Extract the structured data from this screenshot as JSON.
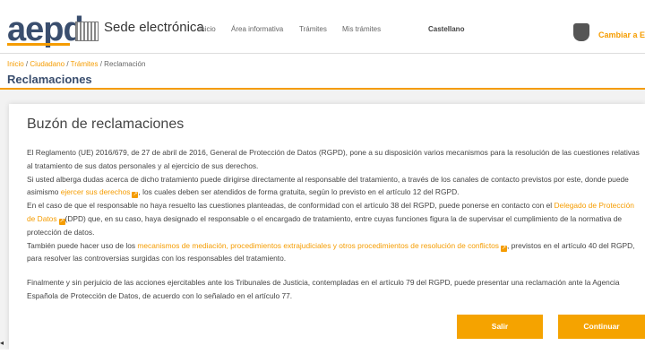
{
  "header": {
    "logo_text": "aepd",
    "site_title": "Sede electrónica",
    "nav": [
      {
        "label": "Inicio"
      },
      {
        "label": "Área informativa"
      },
      {
        "label": "Trámites"
      },
      {
        "label": "Mis trámites"
      }
    ],
    "language": "Castellano",
    "cambiar": "Cambiar a En"
  },
  "breadcrumb": {
    "inicio": "Inicio",
    "sep": "/",
    "ciudadano": "Ciudadano",
    "tramites": "Trámites",
    "current": "Reclamación"
  },
  "page_title": "Reclamaciones",
  "card": {
    "title": "Buzón de reclamaciones",
    "p1": "El Reglamento (UE) 2016/679, de 27 de abril de 2016, General de Protección de Datos (RGPD), pone a su disposición varios mecanismos para la resolución de las cuestiones relativas al tratamiento de sus datos personales y al ejercicio de sus derechos.",
    "p2_a": "Si usted alberga dudas acerca de dicho tratamiento puede dirigirse directamente al responsable del tratamiento, a través de los canales de contacto previstos por este, donde puede asimismo",
    "p2_link": "ejercer sus derechos",
    "p2_b": ", los cuales deben ser atendidos de forma gratuita, según lo previsto en el artículo 12 del RGPD.",
    "p3_a": "En el caso de que el responsable no haya resuelto las cuestiones planteadas, de conformidad con el artículo 38 del RGPD, puede ponerse en contacto con el",
    "p3_link": "Delegado de Protección de Datos",
    "p3_b": "(DPD) que, en su caso, haya designado el responsable o el encargado de tratamiento, entre cuyas funciones figura la de supervisar el cumplimiento de la normativa de protección de datos.",
    "p4_a": "También puede hacer uso de los",
    "p4_link": "mecanismos de mediación, procedimientos extrajudiciales y otros procedimientos de resolución de conflictos",
    "p4_b": ", previstos en el artículo 40 del RGPD, para resolver las controversias surgidas con los responsables del tratamiento.",
    "p5": "Finalmente y sin perjuicio de las acciones ejercitables ante los Tribunales de Justicia, contempladas en el artículo 79 del RGPD, puede presentar una reclamación ante la Agencia Española de Protección de Datos, de acuerdo con lo señalado en el artículo 77.",
    "buttons": {
      "salir": "Salir",
      "continuar": "Continuar"
    }
  },
  "icons": {
    "external_link": "external-link-icon",
    "scroll_left": "◂"
  },
  "colors": {
    "accent": "#f59c00",
    "button": "#f5a300",
    "title": "#3a4e6e"
  }
}
